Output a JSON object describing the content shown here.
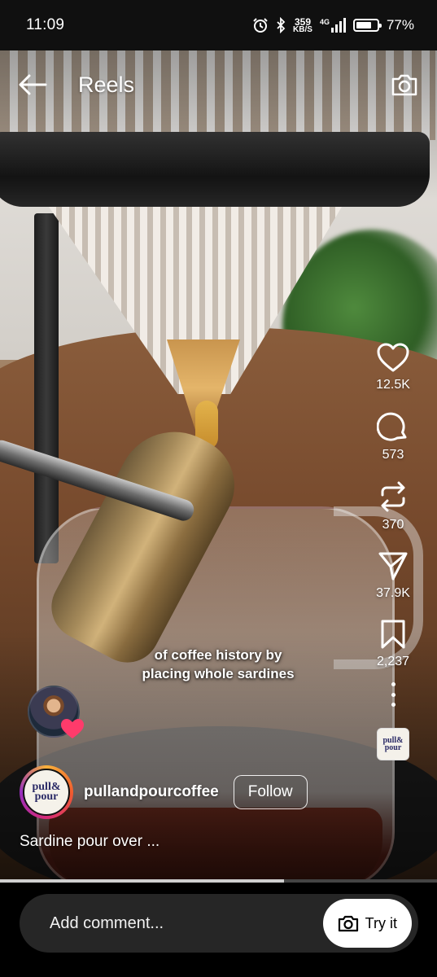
{
  "status_bar": {
    "time": "11:09",
    "speed_value": "359",
    "speed_unit": "KB/S",
    "network": "4G",
    "battery_percent": "77%",
    "battery_level": 0.77
  },
  "header": {
    "title": "Reels",
    "back_icon": "arrow-left-icon",
    "camera_icon": "camera-icon"
  },
  "actions": {
    "likes": "12.5K",
    "comments": "573",
    "reposts": "370",
    "shares": "37.9K",
    "saves": "2,237"
  },
  "video": {
    "caption_line1": "of coffee history by",
    "caption_line2": "placing whole sardines"
  },
  "author": {
    "username": "pullandpourcoffee",
    "follow_label": "Follow",
    "logo_line1": "pull&",
    "logo_line2": "pour",
    "description": "Sardine pour over ..."
  },
  "audio": {
    "logo_line1": "pull&",
    "logo_line2": "pour"
  },
  "playback": {
    "progress": 0.65
  },
  "comment_bar": {
    "placeholder": "Add comment...",
    "try_it_label": "Try it"
  },
  "colors": {
    "background": "#000000",
    "comment_box": "#262626",
    "heart_badge": "#ff3b6b"
  }
}
